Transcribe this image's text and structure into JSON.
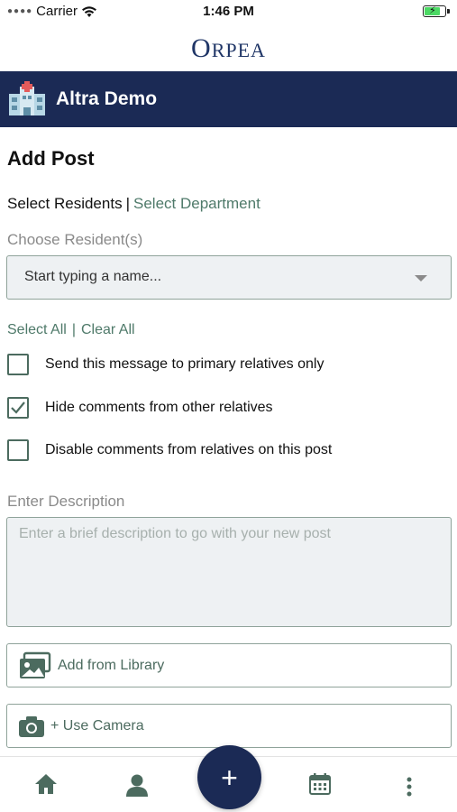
{
  "status_bar": {
    "carrier": "Carrier",
    "time": "1:46 PM",
    "battery_icon": "battery-charging-icon"
  },
  "logo": {
    "text_big": "O",
    "text_rest": "RPEA"
  },
  "header": {
    "title": "Altra Demo",
    "icon": "hospital-icon"
  },
  "page": {
    "title": "Add Post",
    "tab_residents": "Select Residents",
    "tab_separator": "|",
    "tab_department": "Select Department",
    "choose_label": "Choose Resident(s)",
    "resident_placeholder": "Start typing a name...",
    "select_all": "Select All",
    "selclear_separator": "|",
    "clear_all": "Clear All",
    "options": [
      {
        "label": "Send this message to primary relatives only",
        "checked": false
      },
      {
        "label": "Hide comments from other relatives",
        "checked": true
      },
      {
        "label": "Disable comments from relatives on this post",
        "checked": false
      }
    ],
    "description_label": "Enter Description",
    "description_placeholder": "Enter a brief description to go with your new post",
    "add_library": "Add from Library",
    "use_camera": "+ Use Camera"
  },
  "bottom_nav": {
    "home": "home-icon",
    "profile": "person-icon",
    "add": "+",
    "calendar": "calendar-icon",
    "more": "more-vertical-icon"
  },
  "colors": {
    "header_bg": "#1b2a55",
    "accent_green": "#4f7a6a",
    "field_bg": "#eef1f3"
  }
}
